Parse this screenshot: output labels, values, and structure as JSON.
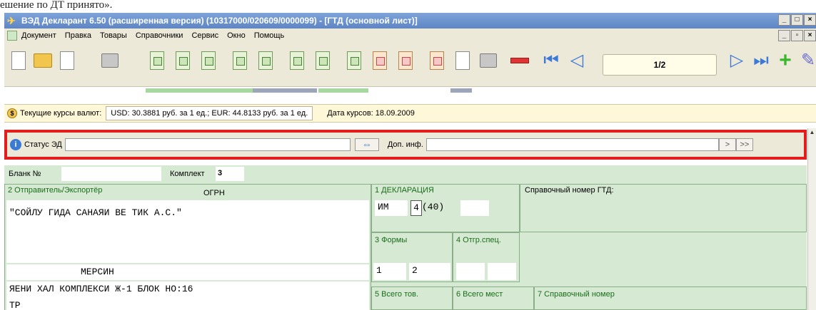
{
  "doc_text": "ешение по ДТ принято».",
  "window": {
    "title": "ВЭД Декларант 6.50 (расширенная версия) (10317000/020609/0000099) - [ГТД (основной лист)]",
    "controls": [
      "_",
      "□",
      "×"
    ],
    "inner_controls": [
      "_",
      "▫",
      "×"
    ]
  },
  "menu": [
    "Документ",
    "Правка",
    "Товары",
    "Справочники",
    "Сервис",
    "Окно",
    "Помощь"
  ],
  "toolbar": {
    "page_indicator": "1/2"
  },
  "rates": {
    "label": "Текущие курсы валют:",
    "value": "USD: 30.3881 руб. за 1 ед.; EUR: 44.8133 руб. за 1 ед.",
    "date": "Дата курсов: 18.09.2009"
  },
  "status": {
    "label": "Статус ЭД",
    "extra_label": "Доп. инф.",
    "next": ">",
    "last": ">>"
  },
  "form": {
    "blank_label": "Бланк №",
    "kit_label": "Комплект",
    "kit_value": "3",
    "sender_label": "2 Отправитель/Экспортёр",
    "ogrn_label": "ОГРН",
    "sender_name": "\"СОЙЛУ ГИДА САНАЯИ ВЕ ТИК А.С.\"",
    "sender_city": "МЕРСИН",
    "sender_address": "ЯЕНИ ХАЛ  КОМПЛЕКСИ Ж-1 БЛОК НО:16",
    "sender_cut": "ТР",
    "decl_label": "1 ДЕКЛАРАЦИЯ",
    "decl_type": "ИМ",
    "decl_code": "4",
    "decl_proc": "(40)",
    "ref_label": "Справочный номер ГТД:",
    "forms_label": "3 Формы",
    "forms_1": "1",
    "forms_2": "2",
    "spec_label": "4 Отгр.спец.",
    "total_goods_label": "5 Всего тов.",
    "total_places_label": "6 Всего мест",
    "ref_number_label": "7 Справочный номер"
  }
}
